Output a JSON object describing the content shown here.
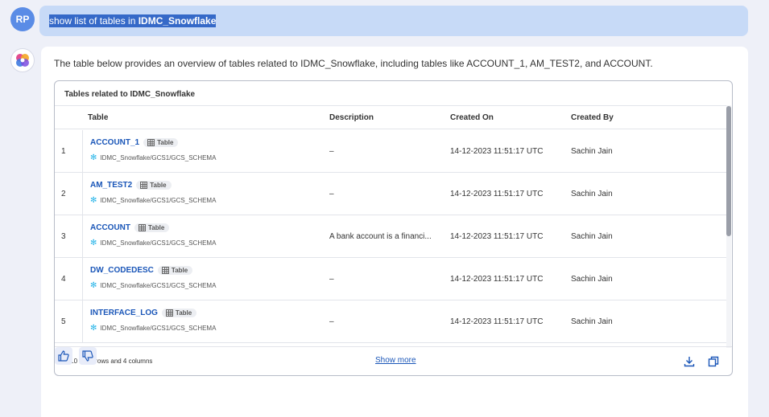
{
  "user": {
    "initials": "RP"
  },
  "prompt": {
    "text_prefix": "show list of tables in ",
    "text_bold": "IDMC_Snowflake"
  },
  "answer": {
    "intro": "The table below provides an overview of tables related to IDMC_Snowflake, including tables like ACCOUNT_1, AM_TEST2, and ACCOUNT.",
    "table": {
      "title": "Tables related to IDMC_Snowflake",
      "columns": [
        "Table",
        "Description",
        "Created On",
        "Created By"
      ],
      "badge_label": "Table",
      "rows": [
        {
          "index": "1",
          "name": "ACCOUNT_1",
          "path": "IDMC_Snowflake/GCS1/GCS_SCHEMA",
          "description": "–",
          "created_on": "14-12-2023 11:51:17 UTC",
          "created_by": "Sachin Jain"
        },
        {
          "index": "2",
          "name": "AM_TEST2",
          "path": "IDMC_Snowflake/GCS1/GCS_SCHEMA",
          "description": "–",
          "created_on": "14-12-2023 11:51:17 UTC",
          "created_by": "Sachin Jain"
        },
        {
          "index": "3",
          "name": "ACCOUNT",
          "path": "IDMC_Snowflake/GCS1/GCS_SCHEMA",
          "description": "A bank account is a financi...",
          "created_on": "14-12-2023 11:51:17 UTC",
          "created_by": "Sachin Jain"
        },
        {
          "index": "4",
          "name": "DW_CODEDESC",
          "path": "IDMC_Snowflake/GCS1/GCS_SCHEMA",
          "description": "–",
          "created_on": "14-12-2023 11:51:17 UTC",
          "created_by": "Sachin Jain"
        },
        {
          "index": "5",
          "name": "INTERFACE_LOG",
          "path": "IDMC_Snowflake/GCS1/GCS_SCHEMA",
          "description": "–",
          "created_on": "14-12-2023 11:51:17 UTC",
          "created_by": "Sachin Jain"
        }
      ],
      "footer": {
        "count": "1-10 of 25 rows and 4 columns",
        "show_more": "Show more"
      }
    }
  },
  "icons": {
    "badge": "table-grid-icon",
    "path": "snowflake-icon",
    "download": "download-icon",
    "copy": "copy-icon",
    "like": "thumbs-up-icon",
    "dislike": "thumbs-down-icon",
    "bot": "ai-assistant-logo-icon"
  },
  "colors": {
    "accent": "#1a56b8",
    "prompt_bg": "#c7daf7",
    "selection": "#3569c8",
    "avatar": "#5a8ce6"
  }
}
